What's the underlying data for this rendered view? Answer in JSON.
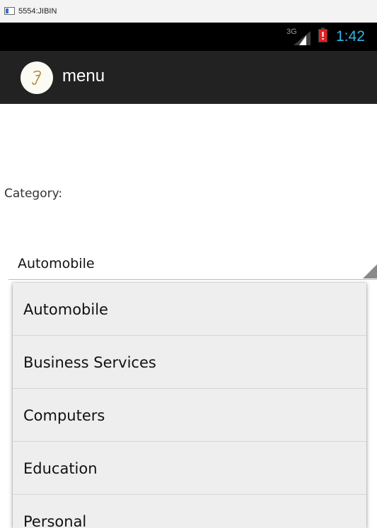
{
  "window": {
    "title": "5554:JIBIN"
  },
  "status_bar": {
    "network": "3G",
    "time": "1:42",
    "time_color": "#33b5e5",
    "battery_color": "#e02020"
  },
  "action_bar": {
    "logo_icon": "app-logo-icon",
    "title": "menu"
  },
  "form": {
    "category_label": "Category:",
    "selected_category": "Automobile"
  },
  "dropdown": {
    "options": [
      "Automobile",
      "Business Services",
      "Computers",
      "Education",
      "Personal"
    ]
  }
}
